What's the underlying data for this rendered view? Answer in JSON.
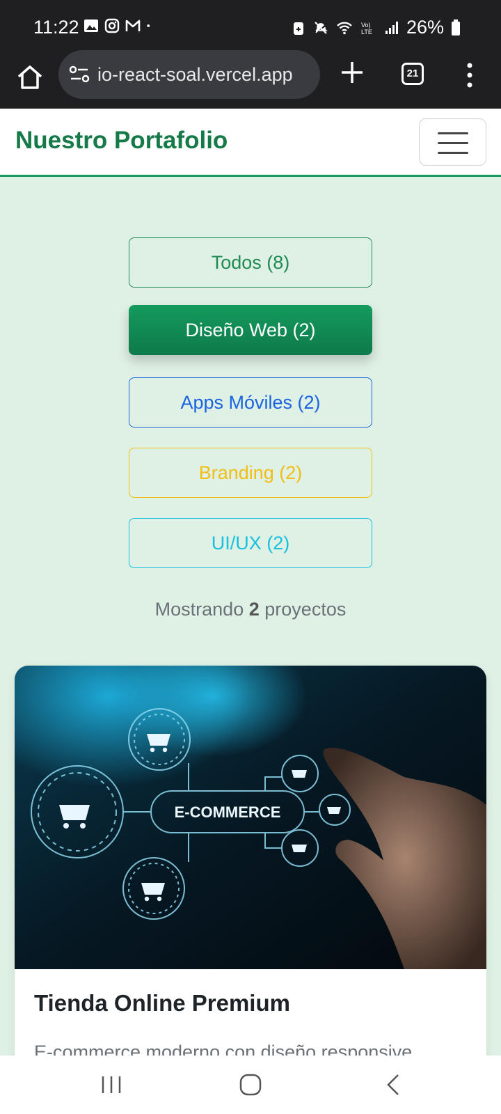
{
  "status_bar": {
    "time": "11:22",
    "battery": "26%",
    "icons": [
      "image-icon",
      "instagram-icon",
      "gmail-icon",
      "dot-icon",
      "battery-saver-icon",
      "mute-icon",
      "wifi-icon",
      "volte-icon",
      "signal-icon",
      "battery-icon"
    ]
  },
  "browser": {
    "url": "io-react-soal.vercel.app",
    "tab_count": "21"
  },
  "navbar": {
    "brand": "Nuestro Portafolio"
  },
  "filters": [
    {
      "label": "Todos (8)",
      "color": "#1e8a54",
      "active": false
    },
    {
      "label": "Diseño Web (2)",
      "color": "#149a5d",
      "active": true
    },
    {
      "label": "Apps Móviles (2)",
      "color": "#1a64e0",
      "active": false
    },
    {
      "label": "Branding (2)",
      "color": "#f2bd14",
      "active": false
    },
    {
      "label": "UI/UX (2)",
      "color": "#17c0de",
      "active": false
    }
  ],
  "results": {
    "prefix": "Mostrando",
    "count": "2",
    "suffix": "proyectos"
  },
  "card": {
    "image_label": "E-COMMERCE",
    "title": "Tienda Online Premium",
    "description": "E-commerce moderno con diseño responsive"
  },
  "colors": {
    "brand": "#157a47",
    "page_background": "#dff0e4"
  }
}
